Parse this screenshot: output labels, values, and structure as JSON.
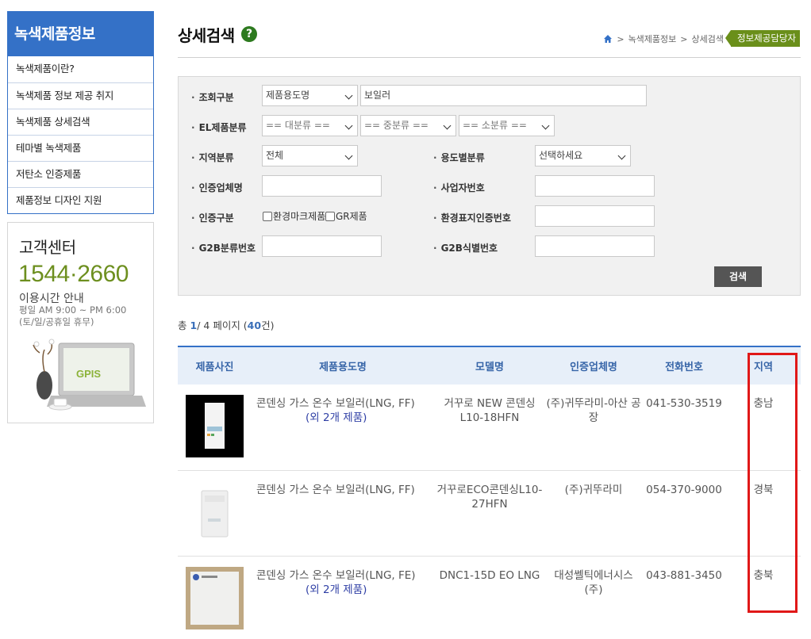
{
  "sidebar": {
    "title": "녹색제품정보",
    "items": [
      {
        "label": "녹색제품이란?"
      },
      {
        "label": "녹색제품 정보 제공 취지"
      },
      {
        "label": "녹색제품 상세검색"
      },
      {
        "label": "테마별 녹색제품"
      },
      {
        "label": "저탄소 인증제품"
      },
      {
        "label": "제품정보 디자인 지원"
      }
    ]
  },
  "customer_center": {
    "title": "고객센터",
    "phone": "1544·2660",
    "hours_title": "이용시간 안내",
    "hours_line1": "평일 AM 9:00 ~ PM 6:00",
    "hours_line2": "(토/일/공휴일 휴무)",
    "laptop_text": "GPIS"
  },
  "header": {
    "title": "상세검색",
    "help": "?",
    "breadcrumb": [
      "녹색제품정보",
      "상세검색"
    ],
    "sep": ">",
    "manager_badge": "정보제공담당자"
  },
  "search": {
    "query_type_label": "조회구분",
    "query_type_value": "제품용도명",
    "query_text": "보일러",
    "el_label": "EL제품분류",
    "el_large": "== 대분류 ==",
    "el_medium": "== 중분류 ==",
    "el_small": "== 소분류 ==",
    "region_label": "지역분류",
    "region_value": "전체",
    "usage_label": "용도별분류",
    "usage_value": "선택하세요",
    "company_label": "인증업체명",
    "biz_label": "사업자번호",
    "cert_label": "인증구분",
    "cert_opt1": "환경마크제품",
    "cert_opt2": "GR제품",
    "eco_label": "환경표지인증번호",
    "g2b_class_label": "G2B분류번호",
    "g2b_id_label": "G2B식별번호",
    "search_button": "검색"
  },
  "summary": {
    "prefix": "총",
    "page": "1",
    "pages": "/ 4 페이지 (",
    "count": "40",
    "suffix": "건)"
  },
  "table": {
    "headers": [
      "제품사진",
      "제품용도명",
      "모델명",
      "인증업체명",
      "전화번호",
      "지역"
    ],
    "rows": [
      {
        "name": "콘덴싱 가스 온수 보일러(LNG, FF)",
        "extra": "(외 2개 제품)",
        "model": "거꾸로 NEW 콘덴싱 L10-18HFN",
        "company": "(주)귀뚜라미-아산 공장",
        "phone": "041-530-3519",
        "region": "충남"
      },
      {
        "name": "콘덴싱 가스 온수 보일러(LNG, FF)",
        "extra": "",
        "model": "거꾸로ECO콘덴싱L10-27HFN",
        "company": "(주)귀뚜라미",
        "phone": "054-370-9000",
        "region": "경북"
      },
      {
        "name": "콘덴싱 가스 온수 보일러(LNG, FE)",
        "extra": "(외 2개 제품)",
        "model": "DNC1-15D EO LNG",
        "company": "대성쎌틱에너시스 (주)",
        "phone": "043-881-3450",
        "region": "충북"
      }
    ]
  },
  "colors": {
    "accent": "#3471c7",
    "green": "#6a8f1a",
    "highlight": "#e01818"
  }
}
